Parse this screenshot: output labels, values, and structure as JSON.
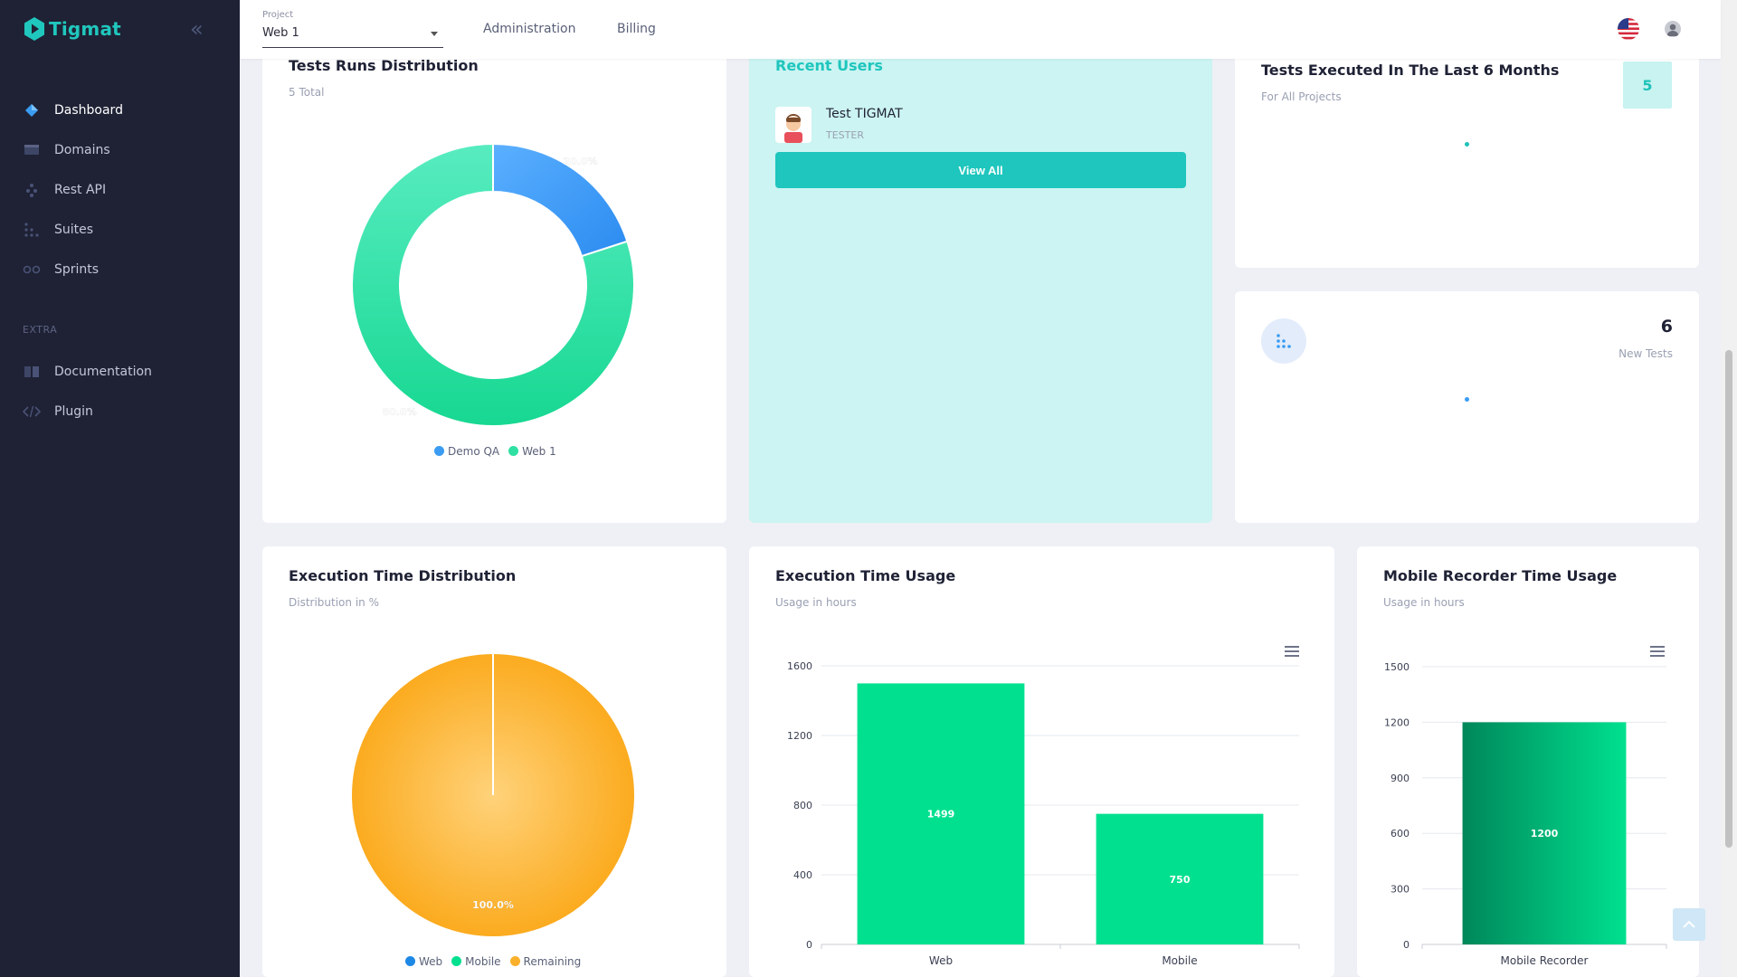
{
  "brand": {
    "name": "Tigmat"
  },
  "sidebar": {
    "items": [
      {
        "label": "Dashboard",
        "icon": "diamond-icon",
        "active": true
      },
      {
        "label": "Domains",
        "icon": "monitor-icon"
      },
      {
        "label": "Rest API",
        "icon": "api-nodes-icon"
      },
      {
        "label": "Suites",
        "icon": "dots-grid-icon"
      },
      {
        "label": "Sprints",
        "icon": "sprint-circles-icon"
      }
    ],
    "extra_section": "EXTRA",
    "extra_items": [
      {
        "label": "Documentation",
        "icon": "book-icon"
      },
      {
        "label": "Plugin",
        "icon": "code-icon"
      }
    ]
  },
  "topbar": {
    "project_label": "Project",
    "project_value": "Web 1",
    "links": [
      "Administration",
      "Billing"
    ]
  },
  "cards": {
    "test_runs": {
      "title": "Tests Runs Distribution",
      "subtitle": "5 Total",
      "legend": [
        "Demo QA",
        "Web 1"
      ]
    },
    "recent_users": {
      "title": "Recent Users",
      "user_name": "Test TIGMAT",
      "user_role": "TESTER",
      "button": "View All"
    },
    "tests_executed": {
      "title": "Tests Executed In The Last 6 Months",
      "subtitle": "For All Projects",
      "badge": "5"
    },
    "new_tests": {
      "value": "6",
      "label": "New Tests"
    },
    "exec_dist": {
      "title": "Execution Time Distribution",
      "subtitle": "Distribution in %",
      "legend": [
        "Web",
        "Mobile",
        "Remaining"
      ]
    },
    "exec_usage": {
      "title": "Execution Time Usage",
      "subtitle": "Usage in hours"
    },
    "mobile_usage": {
      "title": "Mobile Recorder Time Usage",
      "subtitle": "Usage in hours"
    }
  },
  "colors": {
    "sidebar_bg": "#1f2235",
    "accent_teal": "#1ec6bd",
    "blue": "#3a9cf2",
    "green": "#00e08f",
    "orange": "#fbb02c"
  },
  "chart_data": [
    {
      "type": "pie",
      "variant": "donut",
      "labels": [
        "Demo QA",
        "Web 1"
      ],
      "values": [
        20.0,
        80.0
      ],
      "data_labels": [
        "20.0%",
        "80.0%"
      ],
      "colors": [
        "#3a9cf2",
        "#2fe0a2"
      ],
      "legend": "bottom"
    },
    {
      "type": "pie",
      "labels": [
        "Web",
        "Mobile",
        "Remaining"
      ],
      "values": [
        0,
        0,
        100.0
      ],
      "data_labels": [
        "100.0%"
      ],
      "colors": [
        "#1e88e5",
        "#00e08f",
        "#fbb02c"
      ],
      "legend": "bottom"
    },
    {
      "type": "bar",
      "categories": [
        "Web",
        "Mobile"
      ],
      "values": [
        1499,
        750
      ],
      "ylim": [
        0,
        1600
      ],
      "yticks": [
        0,
        400,
        800,
        1200,
        1600
      ],
      "grid": true
    },
    {
      "type": "bar",
      "categories": [
        "Mobile Recorder"
      ],
      "values": [
        1200
      ],
      "ylim": [
        0,
        1500
      ],
      "yticks": [
        0,
        300,
        600,
        900,
        1200,
        1500
      ],
      "grid": true
    }
  ]
}
